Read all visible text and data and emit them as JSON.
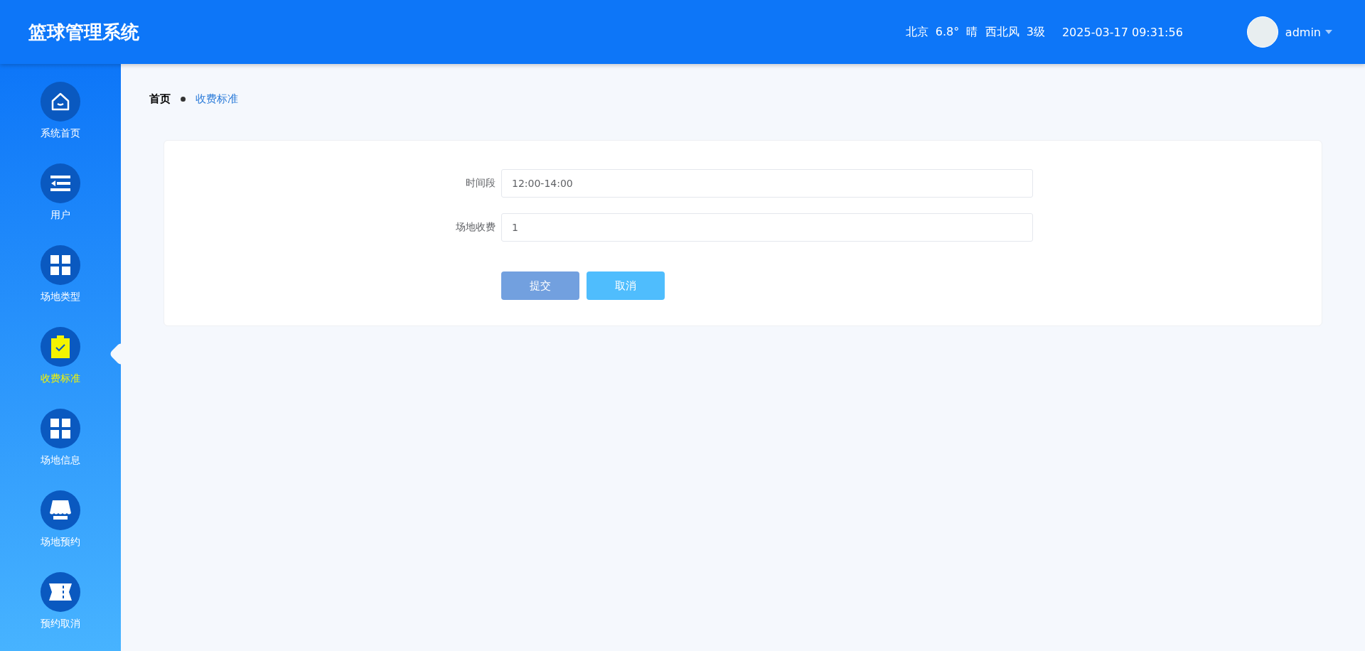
{
  "header": {
    "title": "篮球管理系统",
    "weather": "北京  6.8°  晴  西北风  3级",
    "datetime": "2025-03-17 09:31:56",
    "user": "admin"
  },
  "sidebar": {
    "items": [
      {
        "label": "系统首页",
        "kind": "home",
        "selected": false
      },
      {
        "label": "用户",
        "kind": "list",
        "selected": false
      },
      {
        "label": "场地类型",
        "kind": "grid",
        "selected": false
      },
      {
        "label": "收费标准",
        "kind": "clipboard",
        "selected": true
      },
      {
        "label": "场地信息",
        "kind": "grid",
        "selected": false
      },
      {
        "label": "场地预约",
        "kind": "shop",
        "selected": false
      },
      {
        "label": "预约取消",
        "kind": "ticket",
        "selected": false
      }
    ]
  },
  "breadcrumb": [
    {
      "label": "首页",
      "selected": false
    },
    {
      "label": "收费标准",
      "selected": true
    }
  ],
  "form": {
    "fields": [
      {
        "label": "时间段",
        "value": "12:00-14:00"
      },
      {
        "label": "场地收费",
        "value": "1"
      }
    ],
    "buttons": [
      {
        "label": "提交",
        "kind": "primary"
      },
      {
        "label": "取消",
        "kind": "secondary"
      }
    ]
  }
}
